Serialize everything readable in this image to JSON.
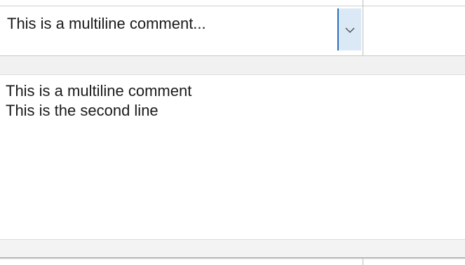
{
  "combo": {
    "value": "This is a multiline comment..."
  },
  "expanded_text": {
    "lines": [
      "This is a multiline comment",
      "This is the second line"
    ]
  },
  "icons": {
    "dropdown": "chevron-down-icon"
  },
  "colors": {
    "dropdown_bg": "#dbe9f6",
    "dropdown_border": "#2a6fb8",
    "band_bg": "#f1f1f1"
  }
}
